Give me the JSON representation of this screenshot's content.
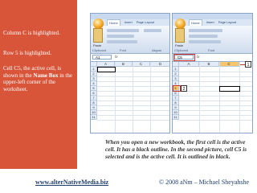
{
  "sidebar": {
    "note1": "Column C is highlighted.",
    "note2": "Row 5 is highlighted.",
    "note3_pre": "Cell C5, the active cell, is shown in the ",
    "note3_bold": "Name Box",
    "note3_post": " in the upper-left corner of the worksheet."
  },
  "screenshots": {
    "left": {
      "tabs": [
        "Home",
        "Insert",
        "Page Layout"
      ],
      "paste_label": "Paste",
      "groups": [
        "Clipboard",
        "Font",
        "Alignm"
      ],
      "namebox": "A1",
      "fx": "fx",
      "columns": [
        "A",
        "B",
        "C",
        "D"
      ],
      "rows": [
        "1",
        "2",
        "3",
        "4",
        "5",
        "6",
        "7",
        "8",
        "9",
        "10",
        "11"
      ]
    },
    "right": {
      "tabs": [
        "Home",
        "Insert",
        "Page Layout"
      ],
      "paste_label": "Paste",
      "groups": [
        "Clipboard",
        "Font"
      ],
      "namebox": "C5",
      "fx": "fx",
      "columns": [
        "A",
        "B",
        "C"
      ],
      "rows": [
        "1",
        "2",
        "3",
        "4",
        "5",
        "6",
        "7",
        "8",
        "9",
        "10",
        "11"
      ],
      "callout_column": "1",
      "callout_row": "2"
    }
  },
  "caption": "When you open a new workbook, the first cell is the active cell. It has a black outline. In the second picture, cell C5 is selected and is the active cell. It is outlined in black.",
  "footer": {
    "url": "www.alterNativeMedia.biz",
    "copyright": "© 2008 aNm – Michael Sheyahshe"
  },
  "colors": {
    "sidebar": "#d8553a",
    "highlight": "#f7c56b",
    "footer_text": "#1f3f6f"
  }
}
